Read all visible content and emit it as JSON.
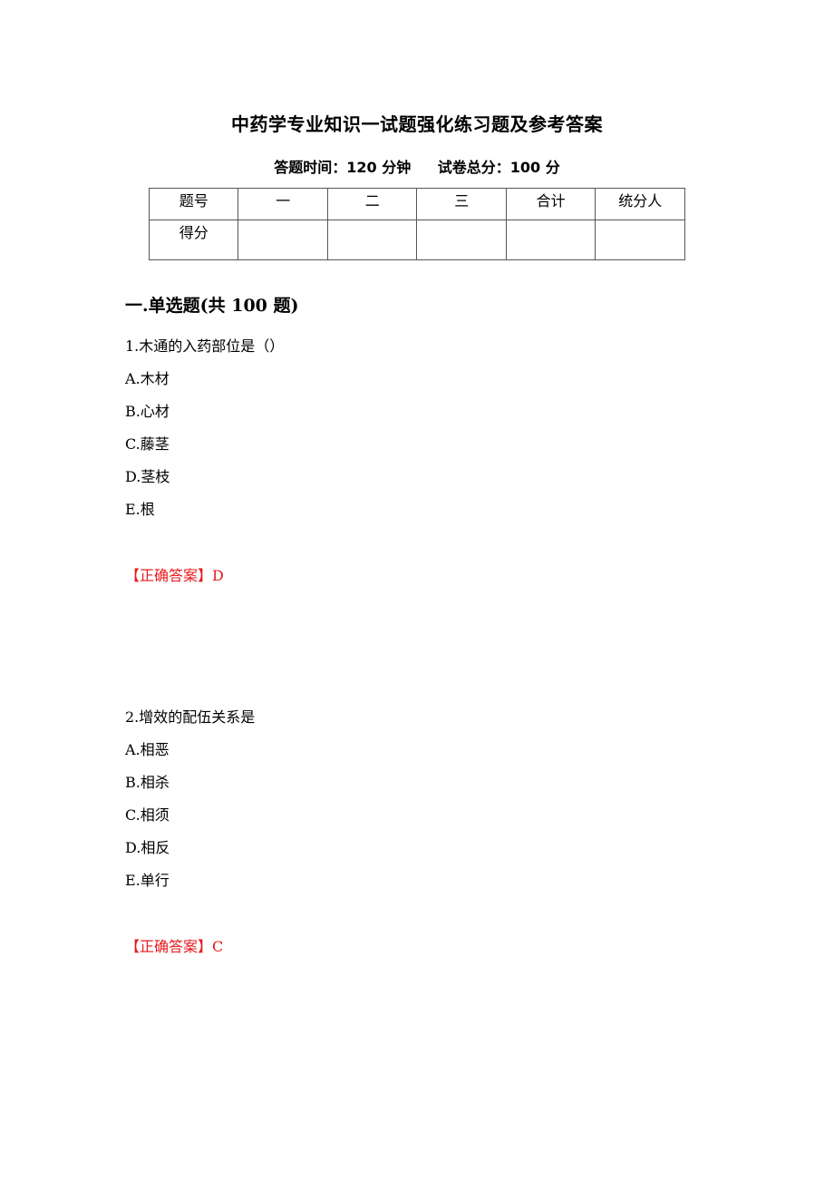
{
  "document": {
    "title": "中药学专业知识一试题强化练习题及参考答案",
    "time_label": "答题时间：120 分钟",
    "score_label": "试卷总分：100 分"
  },
  "score_table": {
    "header": [
      "题号",
      "一",
      "二",
      "三",
      "合计",
      "统分人"
    ],
    "row": [
      "得分",
      "",
      "",
      "",
      "",
      ""
    ]
  },
  "section": {
    "heading": "一.单选题(共 100 题)"
  },
  "questions": [
    {
      "stem": "1.木通的入药部位是（）",
      "options": [
        "A.木材",
        "B.心材",
        "C.藤茎",
        "D.茎枝",
        "E.根"
      ],
      "answer_label": "【正确答案】D"
    },
    {
      "stem": "2.增效的配伍关系是",
      "options": [
        "A.相恶",
        "B.相杀",
        "C.相须",
        "D.相反",
        "E.单行"
      ],
      "answer_label": "【正确答案】C"
    }
  ],
  "colors": {
    "answer": "#e8191c",
    "text": "#000000"
  }
}
